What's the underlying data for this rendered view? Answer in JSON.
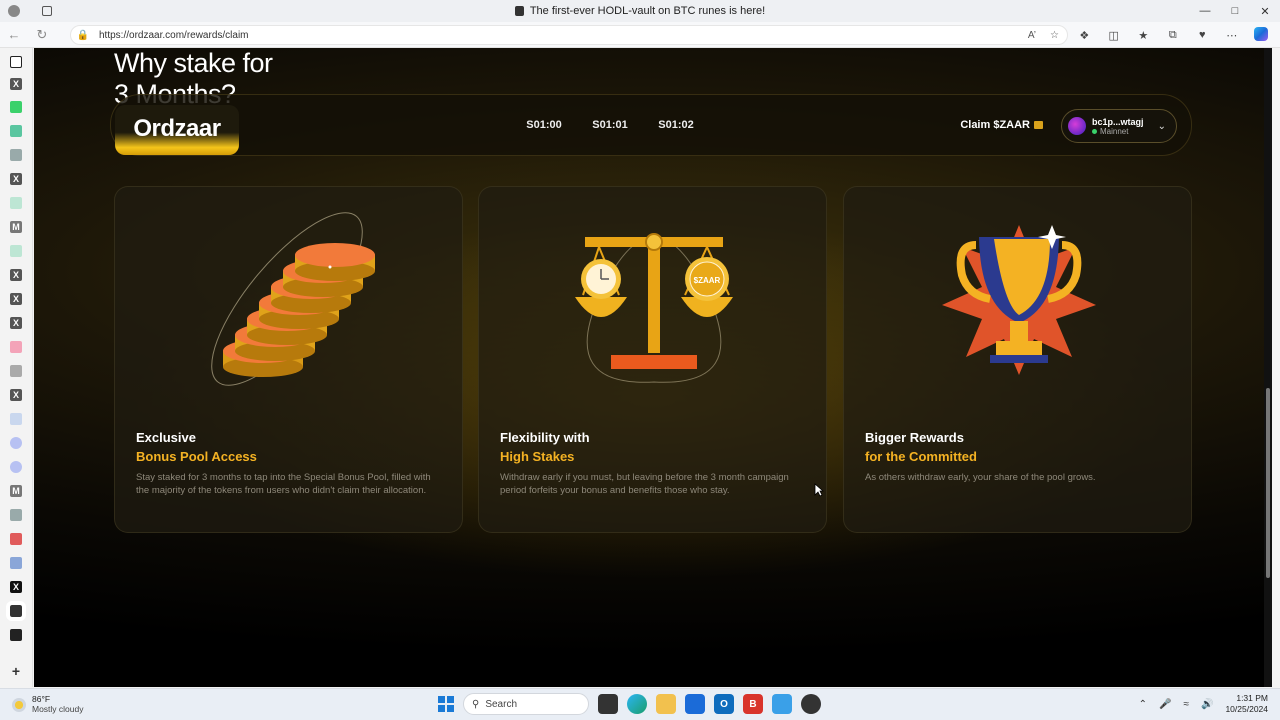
{
  "browser": {
    "tab_title": "The first-ever HODL-vault on BTC runes is here!",
    "url": "https://ordzaar.com/rewards/claim",
    "minimize": "—",
    "maximize": "□",
    "close": "✕"
  },
  "page": {
    "hero_title_line1": "Why stake for",
    "hero_title_line2": "3 Months?",
    "header": {
      "logo_text": "Ordzaar",
      "nav": [
        "S01:00",
        "S01:01",
        "S01:02"
      ],
      "claim_label": "Claim $ZAAR",
      "wallet_address": "bc1p...wtagj",
      "wallet_network": "Mainnet"
    },
    "cards": [
      {
        "title": "Exclusive",
        "subtitle": "Bonus Pool Access",
        "description": "Stay staked for 3 months to tap into the Special Bonus Pool, filled with the majority of the tokens from users who didn't claim their allocation.",
        "icon": "coin-stack"
      },
      {
        "title": "Flexibility with",
        "subtitle": "High Stakes",
        "description": "Withdraw early if you must, but leaving before the 3 month campaign period forfeits your bonus and benefits those who stay.",
        "icon": "balance-scale",
        "scale_label": "$ZAAR"
      },
      {
        "title": "Bigger Rewards",
        "subtitle": "for the Committed",
        "description": "As others withdraw early, your share of the pool grows.",
        "icon": "trophy"
      }
    ]
  },
  "taskbar": {
    "temperature": "86°F",
    "weather": "Mostly cloudy",
    "search_placeholder": "Search",
    "time": "1:31 PM",
    "date": "10/25/2024"
  },
  "colors": {
    "accent_gold": "#f4b223",
    "page_bg": "#0a0804"
  }
}
